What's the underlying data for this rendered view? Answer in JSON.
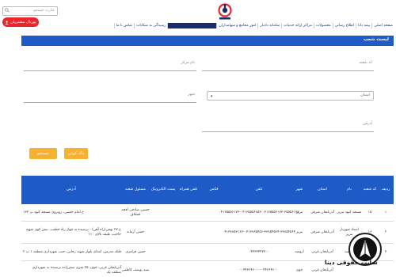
{
  "header": {
    "search_placeholder": "عبارت جستجو",
    "portal_label": "پورتال مشتریان",
    "nav": [
      {
        "label": "صفحه اصلی"
      },
      {
        "label": "بیمه دانا"
      },
      {
        "label": "اطلاع رسانی"
      },
      {
        "label": "محصولات"
      },
      {
        "label": "مراکز ارائه خدمات"
      },
      {
        "label": "سامانه دادیار"
      },
      {
        "label": "امور مجامع و سهامداران"
      },
      {
        "label": ""
      },
      {
        "label": "رسیدگی به شکایات"
      },
      {
        "label": "تماس با ما"
      }
    ]
  },
  "page": {
    "title": "لیست شعب"
  },
  "form": {
    "branch_code_label": "کد شعبه",
    "center_name_label": "نام مرکز",
    "province_label": "استان",
    "city_label": "شهر",
    "address_label": "آدرس",
    "clear_button": "پاک کردن",
    "search_button": "جستجو"
  },
  "table": {
    "headers": [
      "ردیف",
      "کد شعبه",
      "نام",
      "استان",
      "شهر",
      "تلفن",
      "فکس",
      "تلفن همراه",
      "پست الکترونیک",
      "مسئول شعبه",
      "آدرس"
    ],
    "rows": [
      {
        "index": "۱",
        "code": "۱۵",
        "name": "مسجد کبود تبریز",
        "province": "آذربایجان شرقی",
        "city": "تبریز",
        "phone": "۰۴۱۳۵۵۵۶۱۷۳-۰۴۱۳۵۵۵۶۸۵۳-۰۴۱۳۵۵۵۶۱۷۳-۳۵۵۵۶۱۷۳",
        "fax": "",
        "mobile": "",
        "email": "",
        "manager": "حسین صادقی اقچه قشلاق",
        "address": "خ امام خمینی، روبروی مسجد کبود پ ۱۳۳"
      },
      {
        "index": "۲",
        "code": "۱۶",
        "name": "استاد شهریار تبریز",
        "province": "آذربایجان شرقی",
        "city": "تبریز",
        "phone": "۰۴۱۳۳۸۵۳۱۶۳-۰۴۱۳۳۸۵۴۵۶-۳۳۸۵۴۵۶۴-۳۳۸۵۴۵۶۴",
        "fax": "",
        "mobile": "",
        "email": "",
        "manager": "حسن آرمانه",
        "address": "خ ۲۷ بهمن(راه آهن) - نرسیده به چهار راه خطیب، نبش کوی شهید حاجب، طبقه بالای ۱۱۰"
      },
      {
        "index": "۳",
        "code": "",
        "name": "ارومیه",
        "province": "آذربایجان غربی",
        "city": "ارومیه",
        "phone": "۰۴۴۳۳۴۴۷۷۰۰",
        "fax": "",
        "mobile": "",
        "email": "",
        "manager": "حسن قرامری",
        "address": "فلکه مدرس، ابتدای بلوار شهید رجایی، جنب شهرداری منطقه ۱ پ ۲"
      },
      {
        "index": "",
        "code": "",
        "name": "",
        "province": "آذربایجان غربی",
        "city": "خوی",
        "phone": "۰۴۴۳۶۴۶۰۰۰-۰۴۴۳۶۴۶۰۰-",
        "fax": "",
        "mobile": "",
        "email": "",
        "manager": "سید یوسف کاظمی",
        "address": "آذربایجان غربی، خوی، ۲۵ متری صفرزاده نرسیده به شهرداری منطقه یک"
      }
    ]
  },
  "watermark": {
    "text": "سایت حقوقی دینا"
  },
  "colors": {
    "brand_blue": "#1e5bc6",
    "nav_blue": "#1a2c6b",
    "portal_red": "#e8262b",
    "button_orange": "#f5b12f"
  }
}
